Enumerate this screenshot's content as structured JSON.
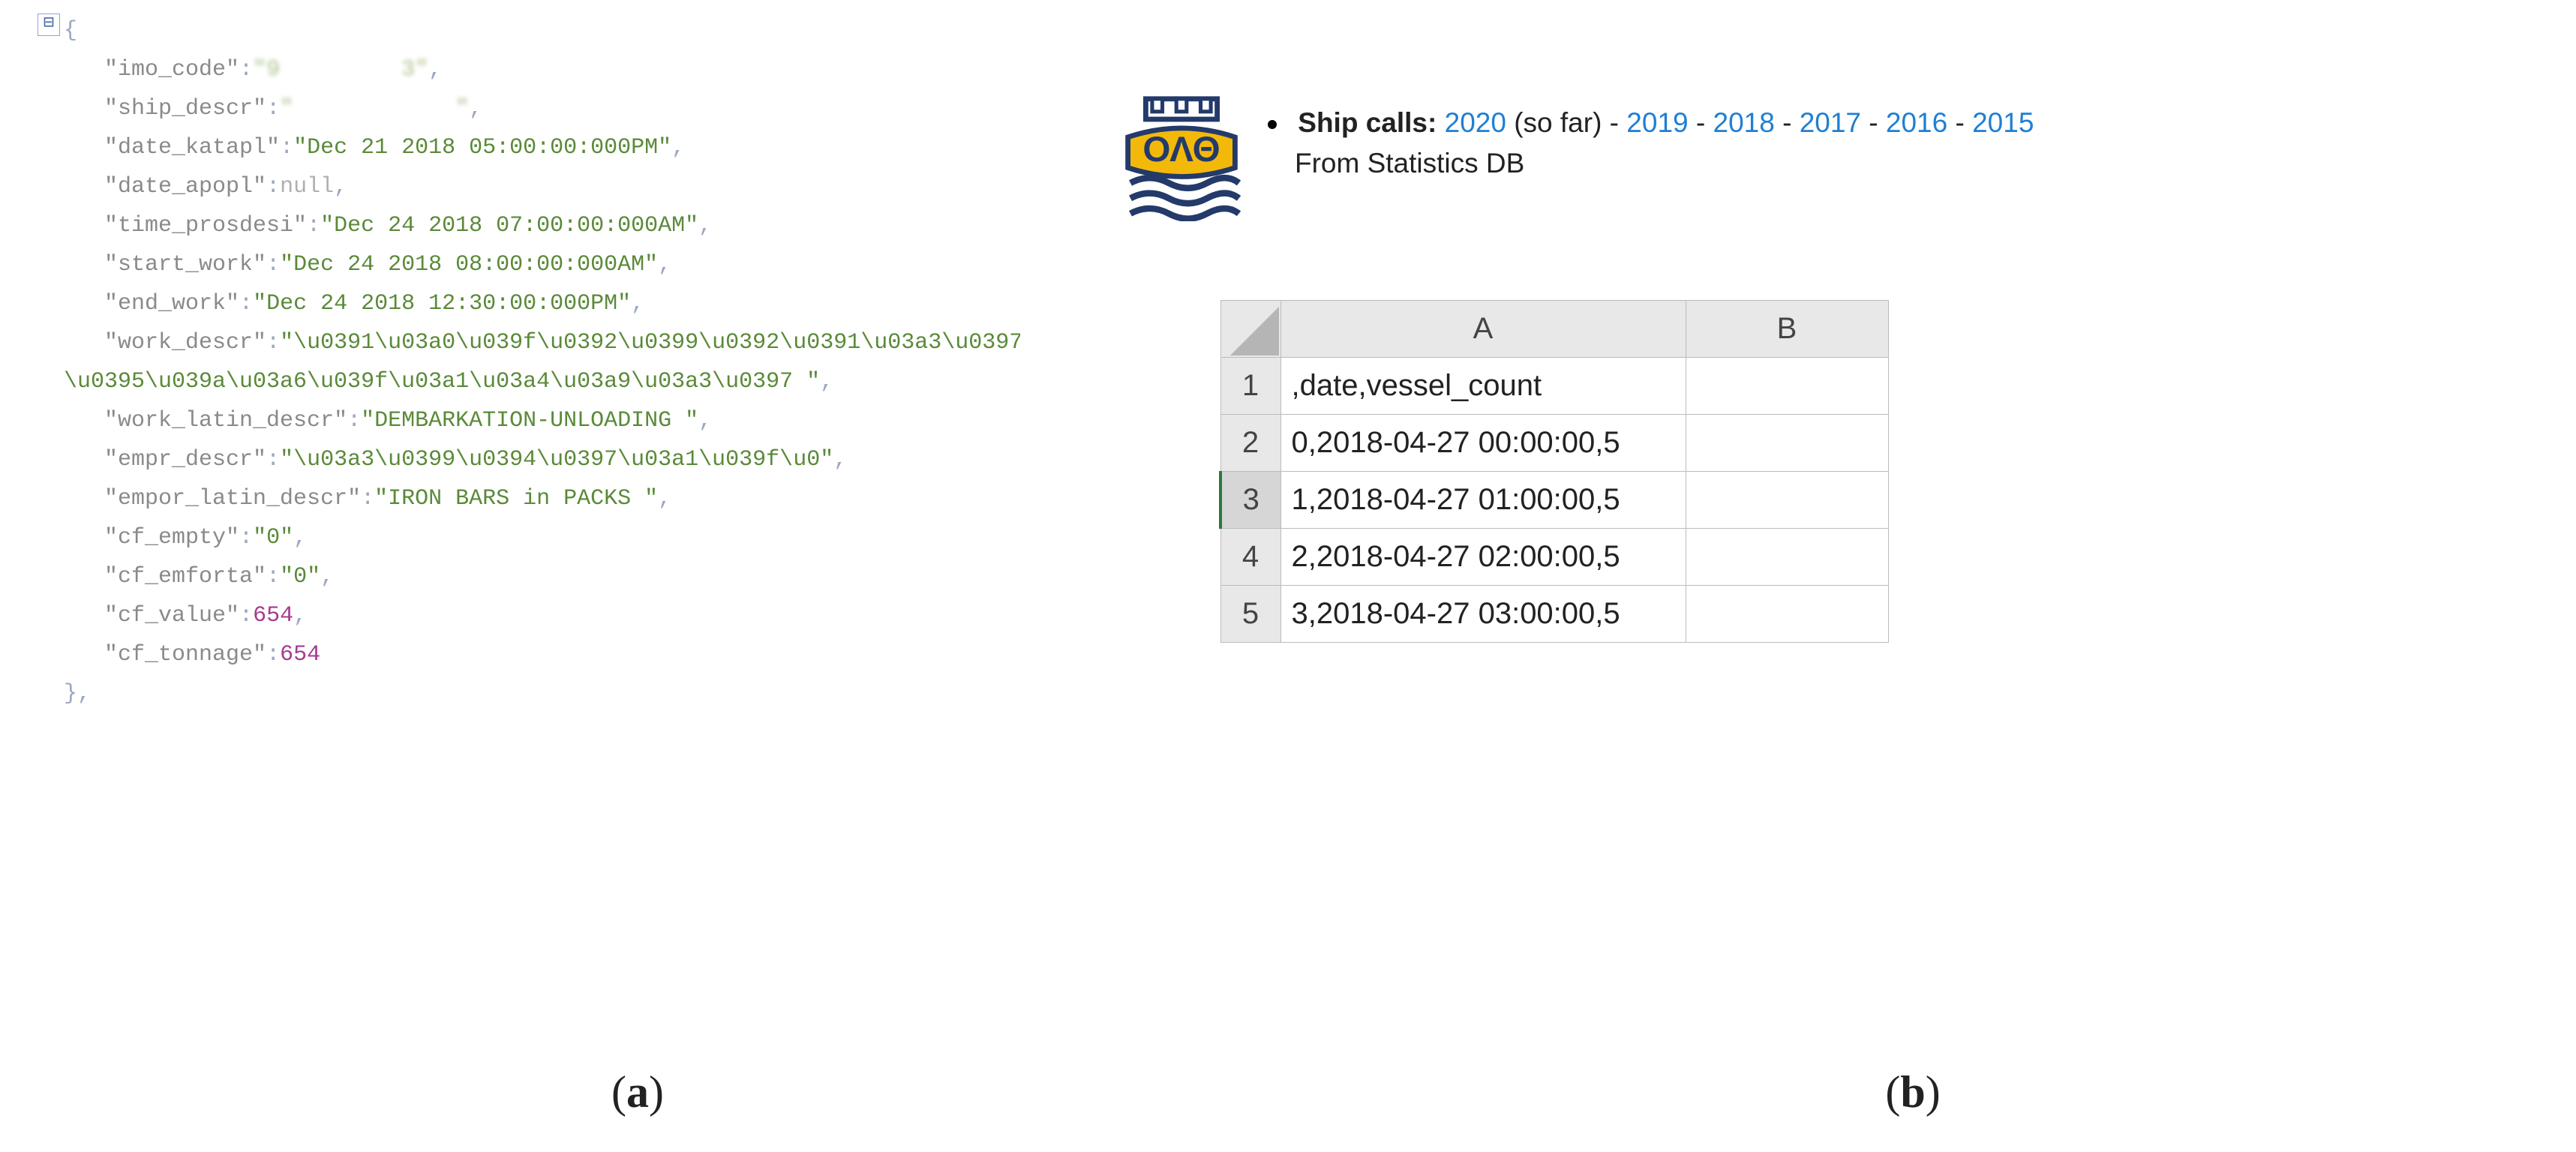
{
  "left": {
    "toggle_glyph": "⊟",
    "open_brace": "{",
    "close_brace": "},",
    "lines": [
      {
        "key": "imo_code",
        "type": "string",
        "value": "9         3",
        "redact": true
      },
      {
        "key": "ship_descr",
        "type": "string",
        "value": "            ",
        "redact": true
      },
      {
        "key": "date_katapl",
        "type": "string",
        "value": "Dec 21 2018 05:00:00:000PM"
      },
      {
        "key": "date_apopl",
        "type": "null",
        "value": "null"
      },
      {
        "key": "time_prosdesi",
        "type": "string",
        "value": "Dec 24 2018 07:00:00:000AM"
      },
      {
        "key": "start_work",
        "type": "string",
        "value": "Dec 24 2018 08:00:00:000AM"
      },
      {
        "key": "end_work",
        "type": "string",
        "value": "Dec 24 2018 12:30:00:000PM"
      },
      {
        "key": "work_descr",
        "type": "string",
        "value": "\\u0391\\u03a0\\u039f\\u0392\\u0399\\u0392\\u0391\\u03a3\\u0397-\\u0395\\u039a\\u03a6\\u039f\\u03a1\\u03a4\\u03a9\\u03a3\\u0397 "
      },
      {
        "key": "work_latin_descr",
        "type": "string",
        "value": "DEMBARKATION-UNLOADING "
      },
      {
        "key": "empr_descr",
        "type": "string",
        "value": "\\u03a3\\u0399\\u0394\\u0397\\u03a1\\u039f\\u0",
        "truncated": true
      },
      {
        "key": "empor_latin_descr",
        "type": "string",
        "value": "IRON BARS in PACKS "
      },
      {
        "key": "cf_empty",
        "type": "string",
        "value": "0"
      },
      {
        "key": "cf_emforta",
        "type": "string",
        "value": "0"
      },
      {
        "key": "cf_value",
        "type": "number",
        "value": "654"
      },
      {
        "key": "cf_tonnage",
        "type": "number",
        "value": "654",
        "no_comma": true
      }
    ]
  },
  "right": {
    "bold_label": "Ship calls:",
    "years": [
      "2020",
      "2019",
      "2018",
      "2017",
      "2016",
      "2015"
    ],
    "so_far": "(so far)",
    "separator": " - ",
    "subline": "From Statistics DB",
    "sheet_cols": [
      "A",
      "B"
    ],
    "rows": [
      {
        "num": "1",
        "a": ",date,vessel_count",
        "b": ""
      },
      {
        "num": "2",
        "a": "0,2018-04-27 00:00:00,5",
        "b": ""
      },
      {
        "num": "3",
        "a": "1,2018-04-27 01:00:00,5",
        "b": "",
        "selected": true
      },
      {
        "num": "4",
        "a": "2,2018-04-27 02:00:00,5",
        "b": ""
      },
      {
        "num": "5",
        "a": "3,2018-04-27 03:00:00,5",
        "b": ""
      }
    ]
  },
  "captions": {
    "a": "(a)",
    "b": "(b)"
  }
}
